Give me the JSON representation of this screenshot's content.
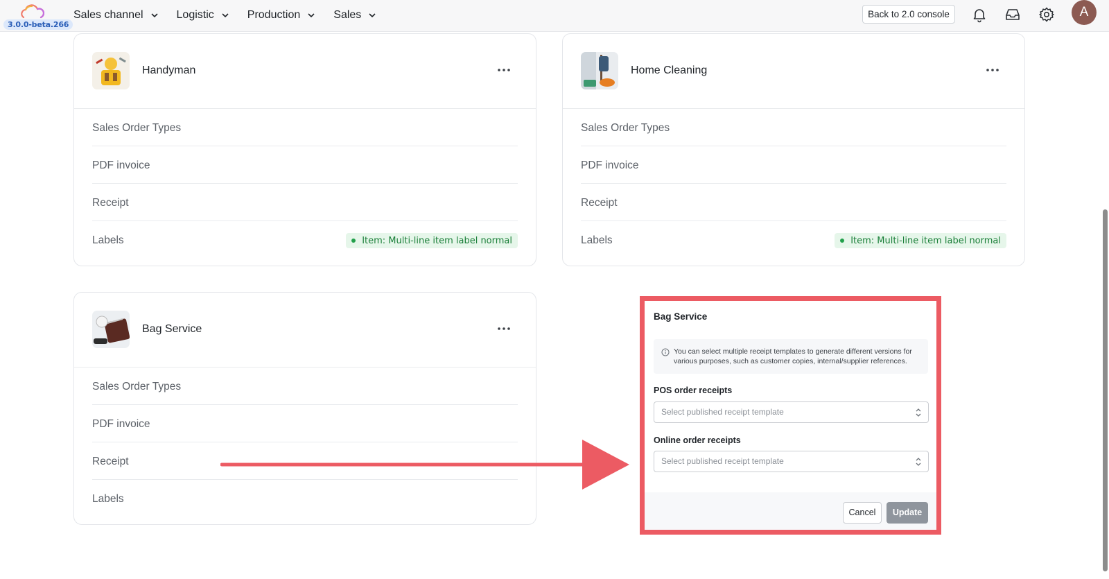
{
  "app": {
    "version": "3.0.0-beta.266"
  },
  "nav": {
    "items": [
      {
        "label": "Sales channel"
      },
      {
        "label": "Logistic"
      },
      {
        "label": "Production"
      },
      {
        "label": "Sales"
      }
    ]
  },
  "header": {
    "back_label": "Back to 2.0 console",
    "avatar_initial": "A",
    "icons": [
      "bell-icon",
      "inbox-icon",
      "gear-icon"
    ]
  },
  "cards": [
    {
      "title": "Handyman",
      "thumb": "handyman-image",
      "rows": [
        {
          "label": "Sales Order Types",
          "tag": ""
        },
        {
          "label": "PDF invoice",
          "tag": ""
        },
        {
          "label": "Receipt",
          "tag": ""
        },
        {
          "label": "Labels",
          "tag": "Item: Multi-line item label normal"
        }
      ]
    },
    {
      "title": "Home Cleaning",
      "thumb": "home-cleaning-image",
      "rows": [
        {
          "label": "Sales Order Types",
          "tag": ""
        },
        {
          "label": "PDF invoice",
          "tag": ""
        },
        {
          "label": "Receipt",
          "tag": ""
        },
        {
          "label": "Labels",
          "tag": "Item: Multi-line item label normal"
        }
      ]
    },
    {
      "title": "Bag Service",
      "thumb": "bag-service-image",
      "rows": [
        {
          "label": "Sales Order Types",
          "tag": ""
        },
        {
          "label": "PDF invoice",
          "tag": ""
        },
        {
          "label": "Receipt",
          "tag": ""
        },
        {
          "label": "Labels",
          "tag": ""
        }
      ]
    }
  ],
  "modal": {
    "title": "Bag Service",
    "info": "You can select multiple receipt templates to generate different versions for various purposes, such as customer copies, internal/supplier references.",
    "pos_label": "POS order receipts",
    "pos_placeholder": "Select published receipt template",
    "online_label": "Online order receipts",
    "online_placeholder": "Select published receipt template",
    "cancel_label": "Cancel",
    "update_label": "Update"
  },
  "colors": {
    "highlight": "#ec5b63",
    "tag_bg": "#e6f6ea",
    "tag_text": "#1a7f38",
    "update_btn": "#8f959d",
    "avatar": "#8c5a52"
  }
}
